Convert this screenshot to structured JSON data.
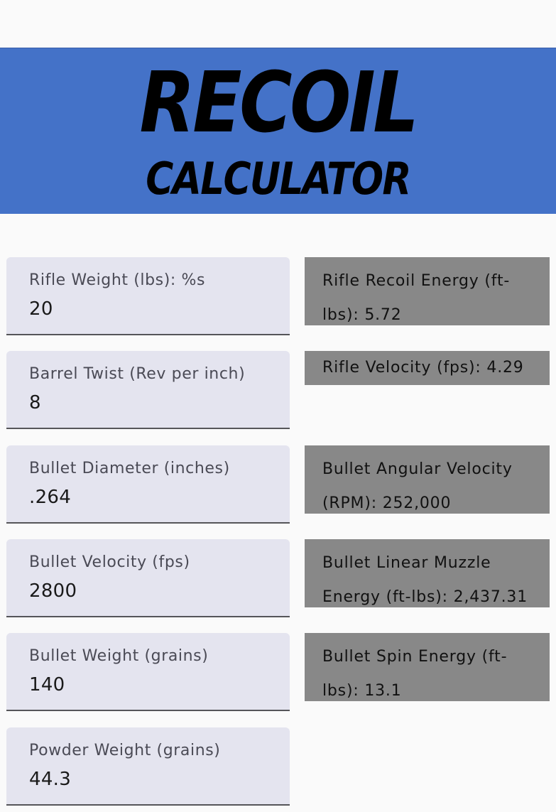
{
  "header": {
    "logo_line1": "RECOIL",
    "logo_line2": "CALCULATOR",
    "banner_color": "#4472c8"
  },
  "inputs": [
    {
      "label": "Rifle Weight (lbs): %s",
      "value": "20"
    },
    {
      "label": "Barrel Twist (Rev per inch)",
      "value": "8"
    },
    {
      "label": "Bullet Diameter (inches)",
      "value": ".264"
    },
    {
      "label": "Bullet Velocity (fps)",
      "value": "2800"
    },
    {
      "label": "Bullet Weight (grains)",
      "value": "140"
    },
    {
      "label": "Powder Weight (grains)",
      "value": "44.3"
    }
  ],
  "results": [
    {
      "text": "Rifle Recoil Energy (ft-lbs): 5.72"
    },
    {
      "text": "Rifle Velocity (fps): 4.29"
    },
    {
      "text": "Bullet Angular Velocity (RPM): 252,000"
    },
    {
      "text": "Bullet Linear Muzzle Energy (ft-lbs): 2,437.31"
    },
    {
      "text": "Bullet Spin Energy (ft-lbs): 13.1"
    }
  ]
}
